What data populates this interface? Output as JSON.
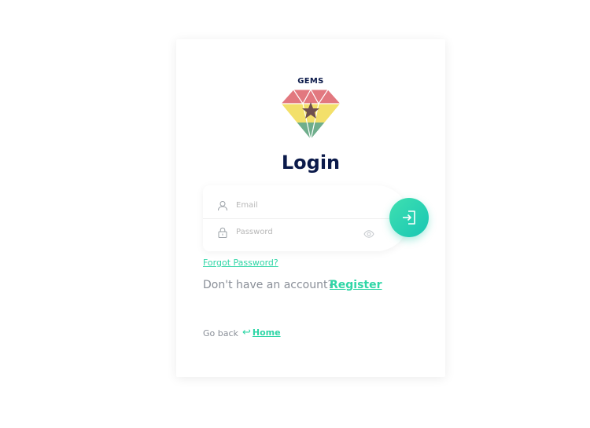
{
  "logo": {
    "text": "GEMS"
  },
  "title": "Login",
  "form": {
    "email": {
      "placeholder": "Email",
      "value": ""
    },
    "password": {
      "placeholder": "Password",
      "value": ""
    }
  },
  "icons": {
    "email": "user-icon",
    "password": "lock-icon",
    "toggle": "eye-icon",
    "submit": "login-icon",
    "back": "return-arrow-icon"
  },
  "links": {
    "forgot_password": "Forgot Password?",
    "no_account": "Don't have an account?",
    "register": "Register",
    "go_back": "Go back",
    "home": "Home",
    "back_arrow": "↩"
  },
  "colors": {
    "accent": "#2fd6a6",
    "title": "#0b1a4a",
    "muted": "#8a8f98"
  }
}
